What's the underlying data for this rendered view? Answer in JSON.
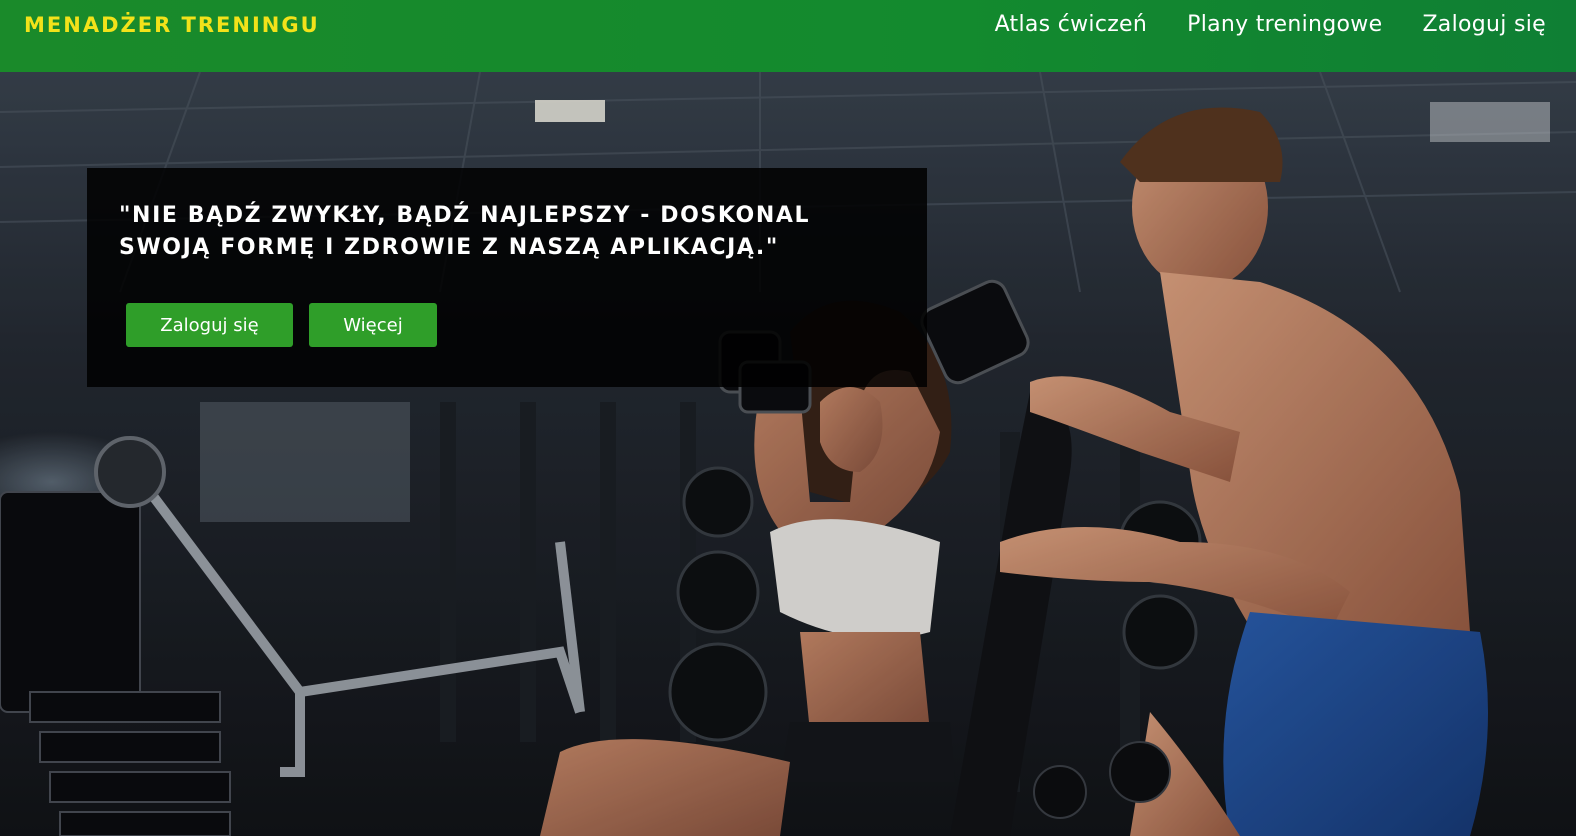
{
  "navbar": {
    "brand": "MENADŻER TRENINGU",
    "links": [
      {
        "label": "Atlas ćwiczeń"
      },
      {
        "label": "Plany treningowe"
      },
      {
        "label": "Zaloguj się"
      }
    ]
  },
  "hero": {
    "quote": "\"NIE BĄDŹ ZWYKŁY, BĄDŹ NAJLEPSZY - DOSKONAL SWOJĄ FORMĘ I ZDROWIE Z NASZĄ APLIKACJĄ.\"",
    "buttons": {
      "login_label": "Zaloguj się",
      "more_label": "Więcej"
    }
  },
  "colors": {
    "navbar_green": "#1a8a2a",
    "brand_yellow": "#f2e21a",
    "button_green": "#2f9e29"
  }
}
